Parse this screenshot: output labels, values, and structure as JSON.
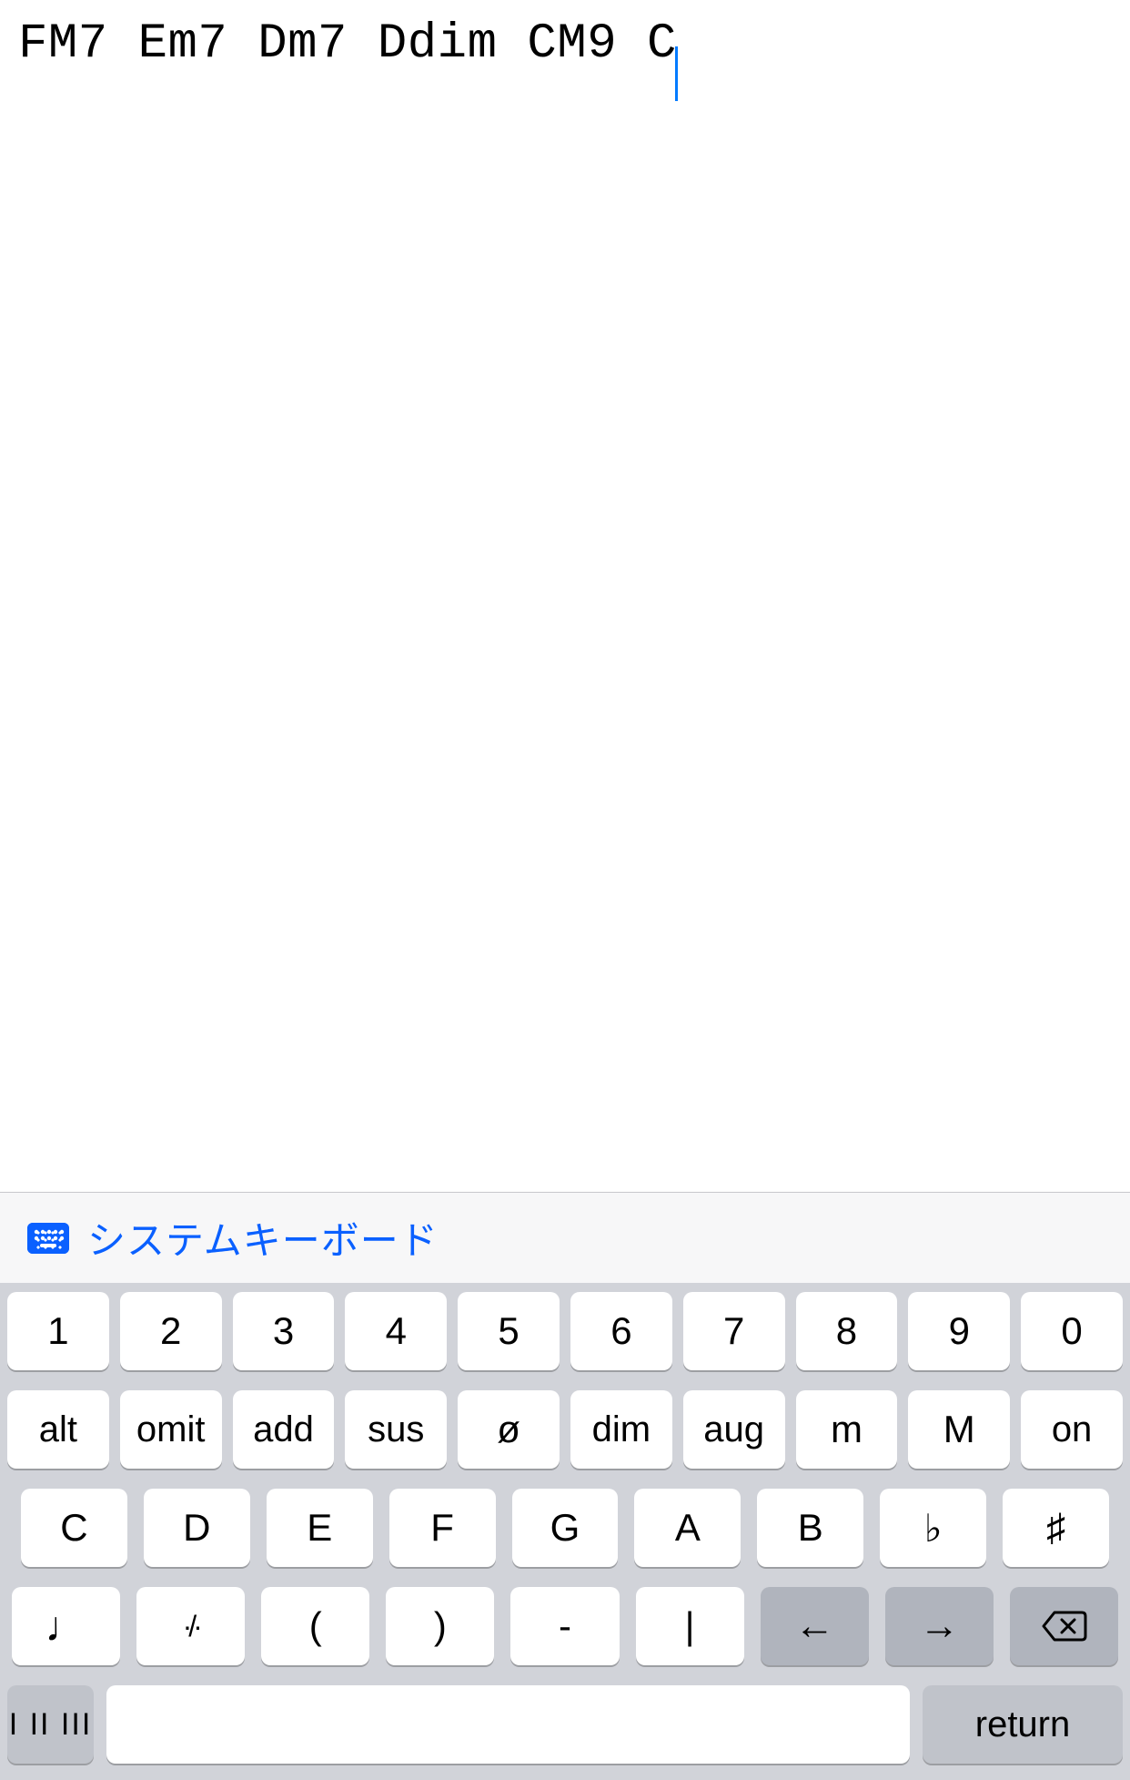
{
  "editor": {
    "text": "FM7 Em7 Dm7 Ddim CM9 C"
  },
  "toolbar": {
    "system_keyboard_label": "システムキーボード"
  },
  "keyboard": {
    "row1": [
      "1",
      "2",
      "3",
      "4",
      "5",
      "6",
      "7",
      "8",
      "9",
      "0"
    ],
    "row2": [
      "alt",
      "omit",
      "add",
      "sus",
      "ø",
      "dim",
      "aug",
      "m",
      "M",
      "on"
    ],
    "row3": [
      "C",
      "D",
      "E",
      "F",
      "G",
      "A",
      "B",
      "♭",
      "♯"
    ],
    "row4": {
      "note": "♩",
      "repeat": "·/·",
      "lparen": "(",
      "rparen": ")",
      "dash": "-",
      "bar": "|",
      "left": "←",
      "right": "→"
    },
    "row5": {
      "mode": "I II III",
      "return": "return"
    }
  }
}
